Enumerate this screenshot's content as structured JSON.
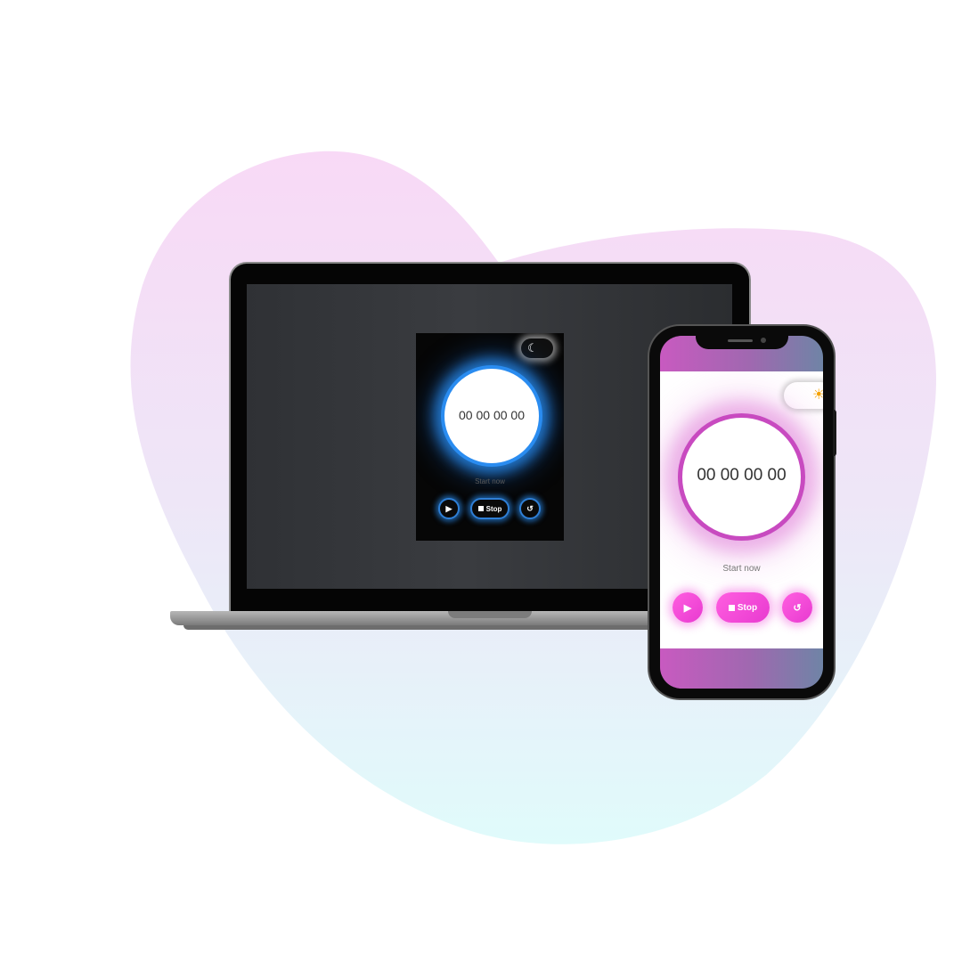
{
  "laptop": {
    "theme": "dark",
    "theme_toggle_icon": "moon-icon",
    "timer": "00 00 00 00",
    "status": "Start now",
    "controls": {
      "play_icon": "play-icon",
      "stop_label": "Stop",
      "reset_icon": "reset-icon"
    },
    "accent_color": "#2a8cf0"
  },
  "phone": {
    "theme": "light",
    "theme_toggle_icon": "sun-icon",
    "timer": "00 00 00 00",
    "status": "Start now",
    "controls": {
      "play_icon": "play-icon",
      "stop_label": "Stop",
      "reset_icon": "reset-icon"
    },
    "accent_color": "#e83ad0"
  }
}
